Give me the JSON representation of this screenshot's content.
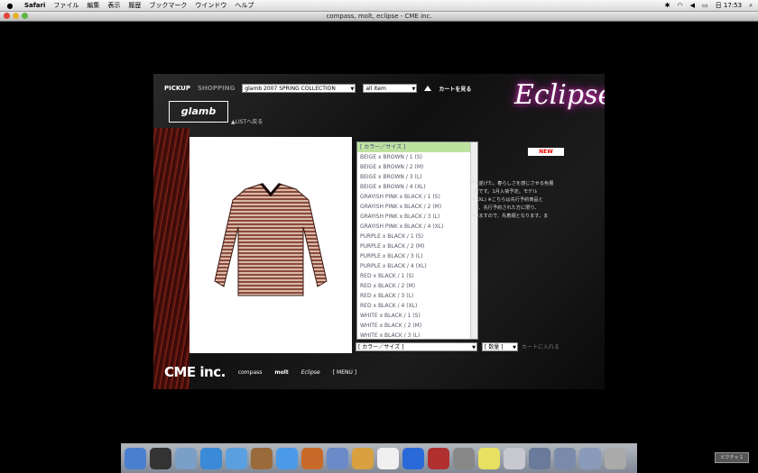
{
  "menubar": {
    "items": [
      "Safari",
      "ファイル",
      "編集",
      "表示",
      "履歴",
      "ブックマーク",
      "ウインドウ",
      "ヘルプ"
    ],
    "clock": "日 17:53"
  },
  "window": {
    "title": "compass, molt, eclipse - CME inc."
  },
  "nav": {
    "pickup": "PICKUP",
    "shopping": "SHOPPING",
    "collection_select": "glamb 2007 SPRING COLLECTION",
    "item_select": "all item",
    "cart_link": "カートを見る"
  },
  "brand": {
    "name": "glamb",
    "back_link": "▲LISTへ戻る"
  },
  "logo": "Eclipse",
  "new_badge": "NEW",
  "description": [
    "頃を遂げた。春らしさを感じさせる色展",
    "ー着です。1月入荷予定。モデル",
    "/ 4 (XL) ※こちらは先行予約商品と",
    "。尚、先行予約された方に限り、",
    "ざいますので、先着順となります。ま"
  ],
  "options": [
    "[ カラー／サイズ ]",
    "BEIGE x BROWN / 1 (S)",
    "BEIGE x BROWN / 2 (M)",
    "BEIGE x BROWN / 3 (L)",
    "BEIGE x BROWN / 4 (XL)",
    "GRAYISH PINK x BLACK / 1 (S)",
    "GRAYISH PINK x BLACK / 2 (M)",
    "GRAYISH PINK x BLACK / 3 (L)",
    "GRAYISH PINK x BLACK / 4 (XL)",
    "PURPLE x BLACK / 1 (S)",
    "PURPLE x BLACK / 2 (M)",
    "PURPLE x BLACK / 3 (L)",
    "PURPLE x BLACK / 4 (XL)",
    "RED x BLACK / 1 (S)",
    "RED x BLACK / 2 (M)",
    "RED x BLACK / 3 (L)",
    "RED x BLACK / 4 (XL)",
    "WHITE x BLACK / 1 (S)",
    "WHITE x BLACK / 2 (M)",
    "WHITE x BLACK / 3 (L)"
  ],
  "color_size_select": "[ カラー／サイズ ]",
  "quantity_select": "[ 数量 ]",
  "add_to_cart": "カートに入れる",
  "footer": {
    "cme": "CME inc.",
    "compass": "compass",
    "molt": "molt",
    "eclipse": "Eclipse",
    "menu": "[ MENU ]"
  },
  "dock_badge": "ピクチャ 1"
}
